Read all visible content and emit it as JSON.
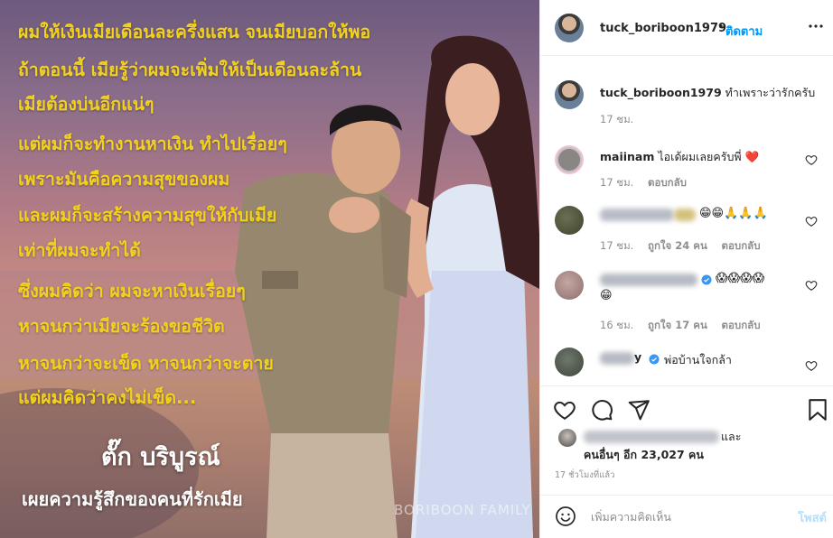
{
  "media": {
    "quote_lines": [
      "ผมให้เงินเมียเดือนละครึ่งแสน จนเมียบอกให้พอ",
      "ถ้าตอนนี้ เมียรู้ว่าผมจะเพิ่มให้เป็นเดือนละล้าน",
      "เมียต้องบ่นอีกแน่ๆ",
      "แต่ผมก็จะทำงานหาเงิน ทำไปเรื่อยๆ",
      "เพราะมันคือความสุขของผม",
      "และผมก็จะสร้างความสุขให้กับเมีย",
      "เท่าที่ผมจะทำได้",
      "ซึ่งผมคิดว่า ผมจะหาเงินเรื่อยๆ",
      "หาจนกว่าเมียจะร้องขอชีวิต",
      "หาจนกว่าจะเข็ด หาจนกว่าจะตาย",
      "แต่ผมคิดว่าคงไม่เข็ด..."
    ],
    "caption_name": "ตั๊ก บริบูรณ์",
    "caption_sub": "เผยความรู้สึกของคนที่รักเมีย",
    "watermark": "BORIBOON FAMILY",
    "colors": {
      "quote": "#f3d21e",
      "caption": "#ffffff"
    }
  },
  "header": {
    "username": "tuck_boriboon1979",
    "separator": "•",
    "follow_label": "ติดตาม",
    "more_icon": "more-horizontal-icon"
  },
  "comments": [
    {
      "username": "tuck_boriboon1979",
      "text": "ทำเพราะว่ารักครับ",
      "time": "17 ชม."
    },
    {
      "username": "maiinam",
      "text": "ไอเด้ผมเลยครับพี่",
      "emoji": "❤️",
      "time": "17 ชม.",
      "reply": "ตอบกลับ"
    },
    {
      "username": "",
      "text": "",
      "emoji": "😁😁🙏🙏🙏",
      "time": "17 ชม.",
      "likes": "ถูกใจ 24 คน",
      "reply": "ตอบกลับ"
    },
    {
      "username": "",
      "text": "",
      "emoji": "😱😱😱😱",
      "emoji2": "😁",
      "time": "16 ชม.",
      "likes": "ถูกใจ 17 คน",
      "reply": "ตอบกลับ"
    },
    {
      "username": "y",
      "text": "พ่อบ้านใจกล้า",
      "time": ""
    }
  ],
  "actions": {
    "likes_suffix": "และ",
    "likes_line2": "คนอื่นๆ อีก 23,027 คน",
    "timestamp": "17 ชั่วโมงที่แล้ว"
  },
  "add_comment": {
    "placeholder": "เพิ่มความคิดเห็น",
    "post_label": "โพสต์"
  },
  "colors": {
    "link": "#0095f6",
    "post_disabled": "#b2dffc",
    "like_heart": "#ed4956"
  }
}
